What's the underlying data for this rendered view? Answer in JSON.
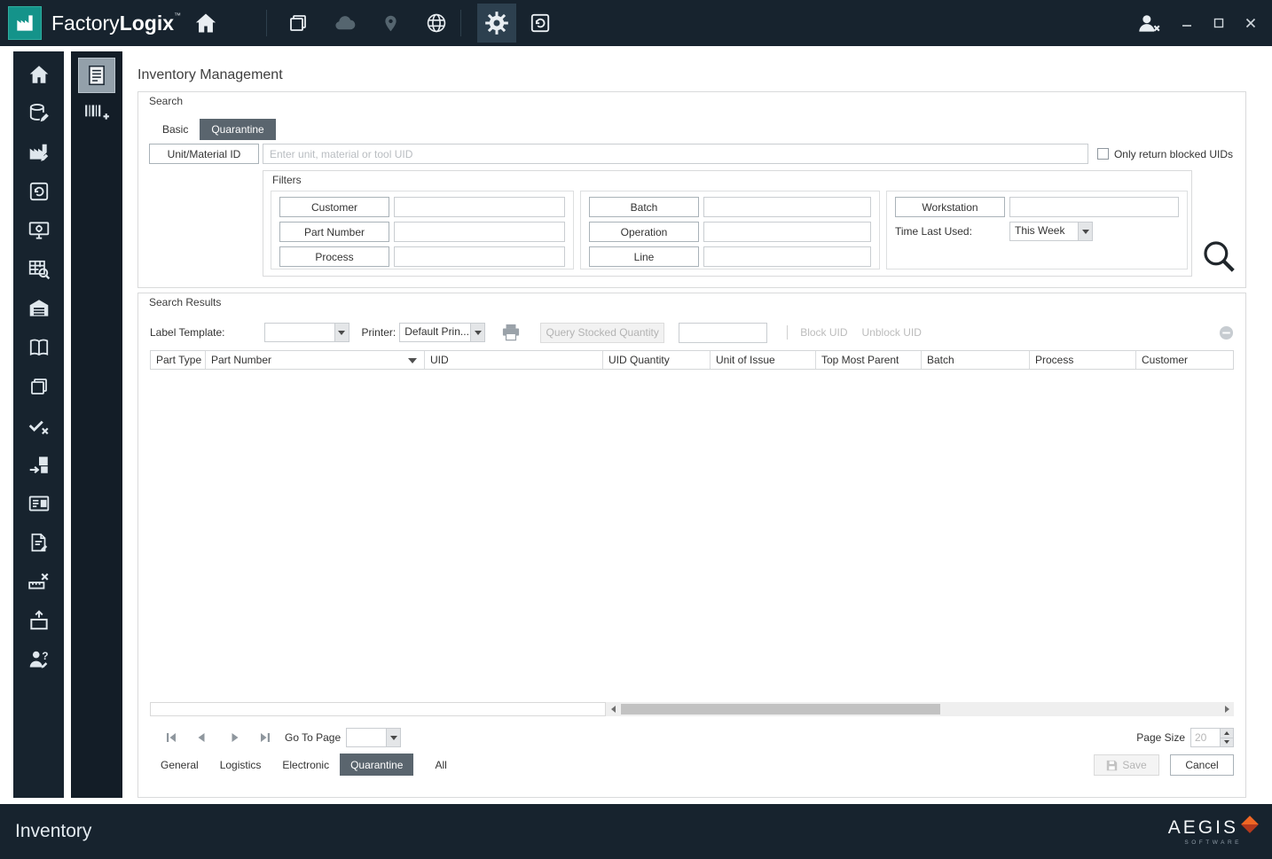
{
  "colors": {
    "titlebar_navy": "#17232e",
    "accent_teal": "#14938a",
    "selected_tab_gray": "#5a656e",
    "brand_orange": "#e2541c"
  },
  "titlebar": {
    "app_name_regular": "Factory",
    "app_name_bold": "Logix",
    "trademark": "™"
  },
  "page": {
    "title": "Inventory Management"
  },
  "search": {
    "group_label": "Search",
    "tabs": [
      {
        "label": "Basic",
        "active": false
      },
      {
        "label": "Quarantine",
        "active": true
      }
    ],
    "unit_material_id_button": "Unit/Material ID",
    "uid_input_placeholder": "Enter unit, material or tool UID",
    "uid_input_value": "",
    "only_blocked_checkbox_label": "Only return blocked UIDs",
    "only_blocked_checked": false,
    "filters": {
      "group_label": "Filters",
      "buttons": [
        "Customer",
        "Part Number",
        "Process",
        "Batch",
        "Operation",
        "Line",
        "Workstation"
      ],
      "values": [
        "",
        "",
        "",
        "",
        "",
        "",
        ""
      ],
      "time_last_used_label": "Time Last Used:",
      "time_last_used_value": "This Week"
    }
  },
  "results": {
    "group_label": "Search Results",
    "toolbar": {
      "label_template_label": "Label Template:",
      "label_template_value": "",
      "printer_label": "Printer:",
      "printer_value": "Default Prin...",
      "query_stocked_quantity_button": "Query Stocked Quantity",
      "quantity_value": "",
      "block_uid_button": "Block UID",
      "unblock_uid_button": "Unblock UID"
    },
    "table": {
      "columns": [
        "Part Type",
        "Part Number",
        "UID",
        "UID Quantity",
        "Unit of Issue",
        "Top Most Parent",
        "Batch",
        "Process",
        "Customer"
      ],
      "sorted_column": "Part Number",
      "rows": []
    },
    "pager": {
      "go_to_page_label": "Go To Page",
      "go_to_page_value": "",
      "page_size_label": "Page Size",
      "page_size_value": "20"
    },
    "category_tabs": [
      "General",
      "Logistics",
      "Electronic",
      "Quarantine",
      "All"
    ],
    "active_category_tab": "Quarantine",
    "save_button": "Save",
    "cancel_button": "Cancel"
  },
  "statusbar": {
    "module_title": "Inventory",
    "brand_name": "AEGIS",
    "brand_subtitle": "SOFTWARE"
  },
  "icons": {
    "titlebar": [
      "factorylogix-logo",
      "home-icon",
      "layers-icon",
      "cloud-icon",
      "map-pin-icon",
      "globe-icon",
      "gear-icon",
      "history-icon",
      "user-logout-icon",
      "minimize-icon",
      "maximize-icon",
      "close-icon"
    ],
    "rail1": [
      "home-icon",
      "database-edit-icon",
      "factory-edit-icon",
      "history-icon",
      "workstation-icon",
      "table-search-icon",
      "warehouse-icon",
      "book-icon",
      "copy-icon",
      "verify-icon",
      "receive-icon",
      "id-card-icon",
      "document-edit-icon",
      "measure-icon",
      "ship-icon",
      "operator-help-icon"
    ],
    "rail2": [
      "inventory-list-icon",
      "barcode-add-icon"
    ],
    "content": [
      "search-magnifier-icon",
      "printer-icon",
      "block-circle-icon",
      "sort-desc-icon",
      "first-page-icon",
      "prev-page-icon",
      "next-page-icon",
      "last-page-icon",
      "save-icon"
    ]
  }
}
